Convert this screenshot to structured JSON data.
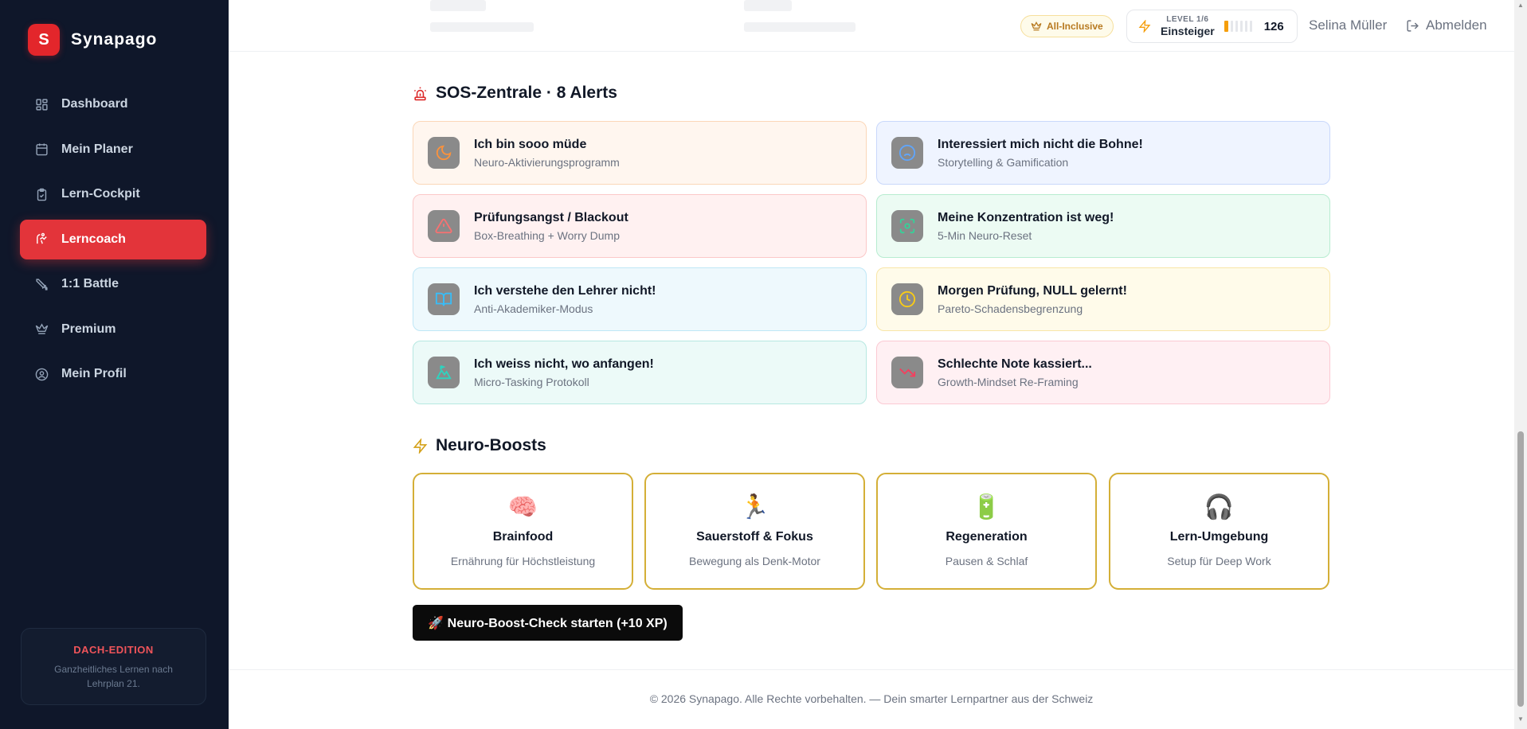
{
  "brand": {
    "logo_letter": "S",
    "name": "Synapago"
  },
  "sidebar": {
    "items": [
      {
        "label": "Dashboard",
        "icon": "dashboard-icon"
      },
      {
        "label": "Mein Planer",
        "icon": "calendar-icon"
      },
      {
        "label": "Lern-Cockpit",
        "icon": "clipboard-icon"
      },
      {
        "label": "Lerncoach",
        "icon": "coach-icon",
        "active": true
      },
      {
        "label": "1:1 Battle",
        "icon": "swords-icon"
      },
      {
        "label": "Premium",
        "icon": "crown-icon"
      },
      {
        "label": "Mein Profil",
        "icon": "user-circle-icon"
      }
    ],
    "edition": {
      "title": "DACH-EDITION",
      "text": "Ganzheitliches Lernen nach Lehrplan 21."
    }
  },
  "topbar": {
    "plan_badge": "All-Inclusive",
    "level": {
      "label": "LEVEL 1/6",
      "name": "Einsteiger",
      "xp": "126",
      "progress_segments_filled": 1,
      "progress_segments_total": 6
    },
    "user_name": "Selina Müller",
    "logout_label": "Abmelden"
  },
  "sos": {
    "title": "SOS-Zentrale · 8 Alerts",
    "alerts": [
      {
        "title": "Ich bin sooo müde",
        "subtitle": "Neuro-Aktivierungsprogramm",
        "icon": "moon-icon"
      },
      {
        "title": "Interessiert mich nicht die Bohne!",
        "subtitle": "Storytelling & Gamification",
        "icon": "sad-face-icon"
      },
      {
        "title": "Prüfungsangst / Blackout",
        "subtitle": "Box-Breathing + Worry Dump",
        "icon": "warning-icon"
      },
      {
        "title": "Meine Konzentration ist weg!",
        "subtitle": "5-Min Neuro-Reset",
        "icon": "focus-icon"
      },
      {
        "title": "Ich verstehe den Lehrer nicht!",
        "subtitle": "Anti-Akademiker-Modus",
        "icon": "book-icon"
      },
      {
        "title": "Morgen Prüfung, NULL gelernt!",
        "subtitle": "Pareto-Schadensbegrenzung",
        "icon": "clock-icon"
      },
      {
        "title": "Ich weiss nicht, wo anfangen!",
        "subtitle": "Micro-Tasking Protokoll",
        "icon": "mountain-icon"
      },
      {
        "title": "Schlechte Note kassiert...",
        "subtitle": "Growth-Mindset Re-Framing",
        "icon": "trending-down-icon"
      }
    ]
  },
  "boosts": {
    "title": "Neuro-Boosts",
    "items": [
      {
        "emoji": "🧠",
        "title": "Brainfood",
        "subtitle": "Ernährung für Höchstleistung"
      },
      {
        "emoji": "🏃",
        "title": "Sauerstoff & Fokus",
        "subtitle": "Bewegung als Denk-Motor"
      },
      {
        "emoji": "🔋",
        "title": "Regeneration",
        "subtitle": "Pausen & Schlaf"
      },
      {
        "emoji": "🎧",
        "title": "Lern-Umgebung",
        "subtitle": "Setup für Deep Work"
      }
    ],
    "cta": "🚀 Neuro-Boost-Check starten (+10 XP)"
  },
  "footer": "© 2026 Synapago. Alle Rechte vorbehalten. — Dein smarter Lernpartner aus der Schweiz",
  "colors": {
    "brand_red": "#e3262b",
    "sidebar_bg": "#0f172a",
    "boost_border": "#d4af37",
    "cta_bg": "#0b0b0b"
  }
}
